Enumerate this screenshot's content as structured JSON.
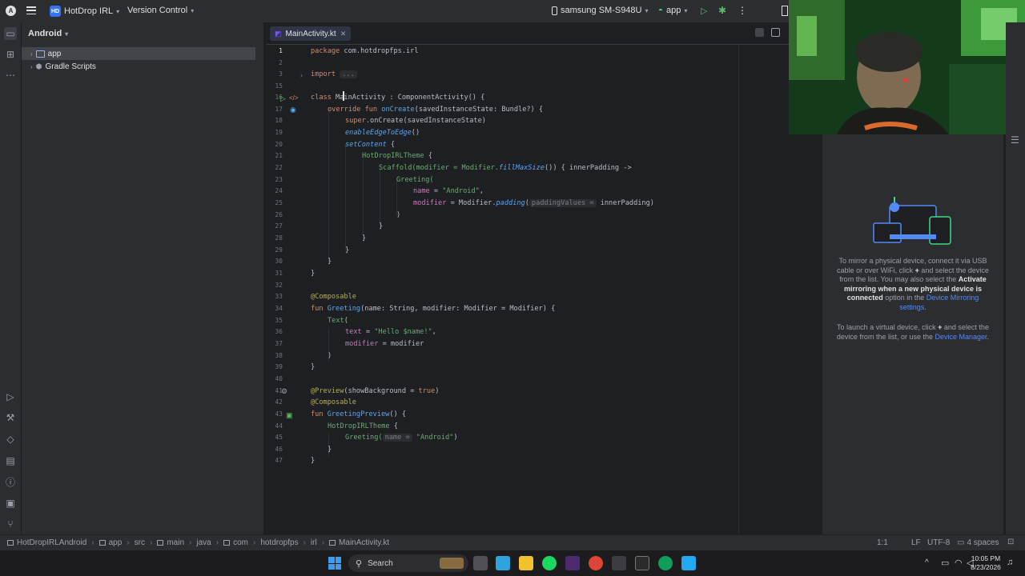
{
  "titlebar": {
    "project_badge": "HD",
    "project_name": "HotDrop IRL",
    "vcs_label": "Version Control",
    "device": "samsung SM-S948U",
    "run_config": "app"
  },
  "project_panel": {
    "view_label": "Android",
    "items": [
      {
        "label": "app",
        "selected": true
      },
      {
        "label": "Gradle Scripts",
        "selected": false
      }
    ]
  },
  "editor": {
    "tab_label": "MainActivity.kt",
    "line_numbers": [
      "1",
      "2",
      "3",
      "15",
      "16",
      "17",
      "18",
      "19",
      "20",
      "21",
      "22",
      "23",
      "24",
      "25",
      "26",
      "27",
      "28",
      "29",
      "30",
      "31",
      "32",
      "33",
      "34",
      "35",
      "36",
      "37",
      "38",
      "39",
      "40",
      "41",
      "42",
      "43",
      "44",
      "45",
      "46",
      "47"
    ],
    "code": {
      "l1_kw": "package",
      "l1_rest": " com.hotdropfps.irl",
      "l3_kw": "import",
      "l3_fold": "...",
      "l16_kw": "class",
      "l16_name": " MainActivity",
      "l16_rest": " : ComponentActivity() {",
      "l17_kw": "override fun",
      "l17_fn": " onCreate",
      "l17_rest": "(savedInstanceState: Bundle?) {",
      "l18_kw": "super",
      "l18_rest": ".onCreate(savedInstanceState)",
      "l19_fn": "enableEdgeToEdge",
      "l19_rest": "()",
      "l20_fn": "setContent",
      "l20_rest": " {",
      "l21_cls": "HotDropIRLTheme",
      "l21_rest": " {",
      "l22_a": "Scaffold(modifier = Modifier.",
      "l22_fn": "fillMaxSize",
      "l22_b": "()) { innerPadding ->",
      "l23": "Greeting(",
      "l24_prop": "name",
      "l24_eq": " = ",
      "l24_str": "\"Android\"",
      "l24_end": ",",
      "l25_prop": "modifier",
      "l25_a": " = Modifier.",
      "l25_fn": "padding",
      "l25_open": "(",
      "l25_hint": "paddingValues =",
      "l25_b": " innerPadding)",
      "l26": ")",
      "l27": "}",
      "l28": "}",
      "l29": "}",
      "l30": "}",
      "l31": "}",
      "l33_ann": "@Composable",
      "l34_kw": "fun",
      "l34_fn": " Greeting",
      "l34_rest": "(name: String, modifier: Modifier = Modifier) {",
      "l35_fn": "Text",
      "l35_rest": "(",
      "l36_prop": "text",
      "l36_eq": " = ",
      "l36_str": "\"Hello $name!\"",
      "l36_end": ",",
      "l37_prop": "modifier",
      "l37_rest": " = modifier",
      "l38": ")",
      "l39": "}",
      "l41_ann": "@Preview",
      "l41_a": "(showBackground = ",
      "l41_kw": "true",
      "l41_b": ")",
      "l42_ann": "@Composable",
      "l43_kw": "fun",
      "l43_fn": " GreetingPreview",
      "l43_rest": "() {",
      "l44_cls": "HotDropIRLTheme",
      "l44_rest": " {",
      "l45_a": "Greeting(",
      "l45_hint": "name =",
      "l45_str": " \"Android\"",
      "l45_b": ")",
      "l46": "}",
      "l47": "}"
    }
  },
  "mirroring": {
    "p1_a": "To mirror a physical device, connect it via USB cable or over WiFi, click",
    "p1_plus": "+",
    "p1_b": "and select the device from the list. You may also select the",
    "p1_bold": "Activate mirroring when a new physical device is connected",
    "p1_c": "option in the",
    "p1_link": "Device Mirroring settings",
    "p1_end": ".",
    "p2_a": "To launch a virtual device, click",
    "p2_plus": "+",
    "p2_b": "and select the device from the list, or use the",
    "p2_link": "Device Manager",
    "p2_end": "."
  },
  "statusbar": {
    "crumbs": [
      "HotDropIRLAndroid",
      "app",
      "src",
      "main",
      "java",
      "com",
      "hotdropfps",
      "irl",
      "MainActivity.kt"
    ],
    "position": "1:1",
    "line_sep": "LF",
    "encoding": "UTF-8",
    "indent": "4 spaces"
  },
  "taskbar": {
    "search_label": "Search",
    "time": "10:05 PM",
    "date": "8/23/2026"
  },
  "colors": {
    "accent": "#3574f0",
    "keyword": "#cf8e6d",
    "function": "#56a8f5",
    "string": "#6aab73",
    "annotation": "#b3ae60"
  }
}
